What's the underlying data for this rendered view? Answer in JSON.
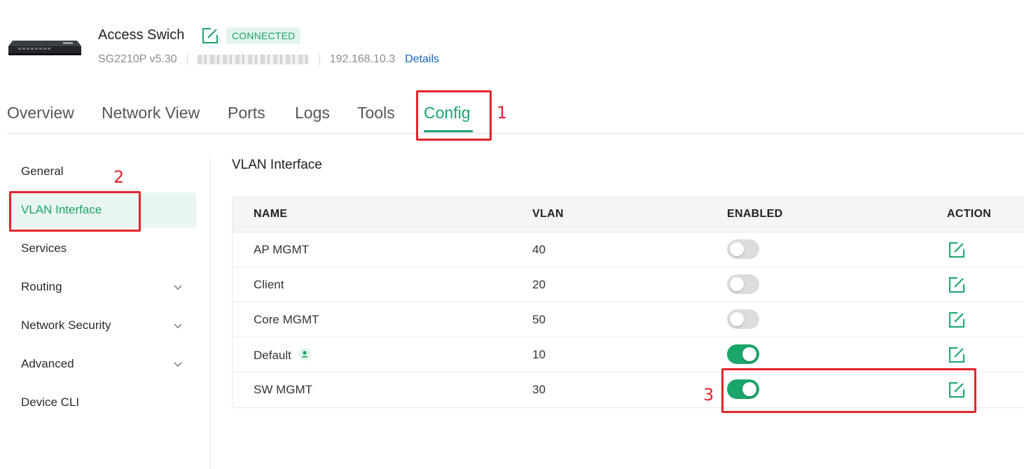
{
  "device": {
    "name": "Access Swich",
    "status": "CONNECTED",
    "model": "SG2210P v5.30",
    "ip": "192.168.10.3",
    "details_link": "Details"
  },
  "tabs": [
    {
      "label": "Overview"
    },
    {
      "label": "Network View"
    },
    {
      "label": "Ports"
    },
    {
      "label": "Logs"
    },
    {
      "label": "Tools"
    },
    {
      "label": "Config",
      "active": true
    }
  ],
  "sidebar": {
    "items": [
      {
        "label": "General"
      },
      {
        "label": "VLAN Interface",
        "active": true
      },
      {
        "label": "Services"
      },
      {
        "label": "Routing",
        "expandable": true
      },
      {
        "label": "Network Security",
        "expandable": true
      },
      {
        "label": "Advanced",
        "expandable": true
      },
      {
        "label": "Device CLI"
      }
    ]
  },
  "main": {
    "title": "VLAN Interface",
    "columns": [
      "NAME",
      "VLAN",
      "ENABLED",
      "ACTION"
    ],
    "rows": [
      {
        "name": "AP MGMT",
        "vlan": "40",
        "enabled": false
      },
      {
        "name": "Client",
        "vlan": "20",
        "enabled": false
      },
      {
        "name": "Core MGMT",
        "vlan": "50",
        "enabled": false
      },
      {
        "name": "Default",
        "vlan": "10",
        "enabled": true,
        "icon": "user-icon"
      },
      {
        "name": "SW MGMT",
        "vlan": "30",
        "enabled": true
      }
    ]
  },
  "annotations": [
    "1",
    "2",
    "3"
  ],
  "colors": {
    "accent": "#1aa56b",
    "annotation": "#e3242b",
    "link": "#1565c0"
  }
}
